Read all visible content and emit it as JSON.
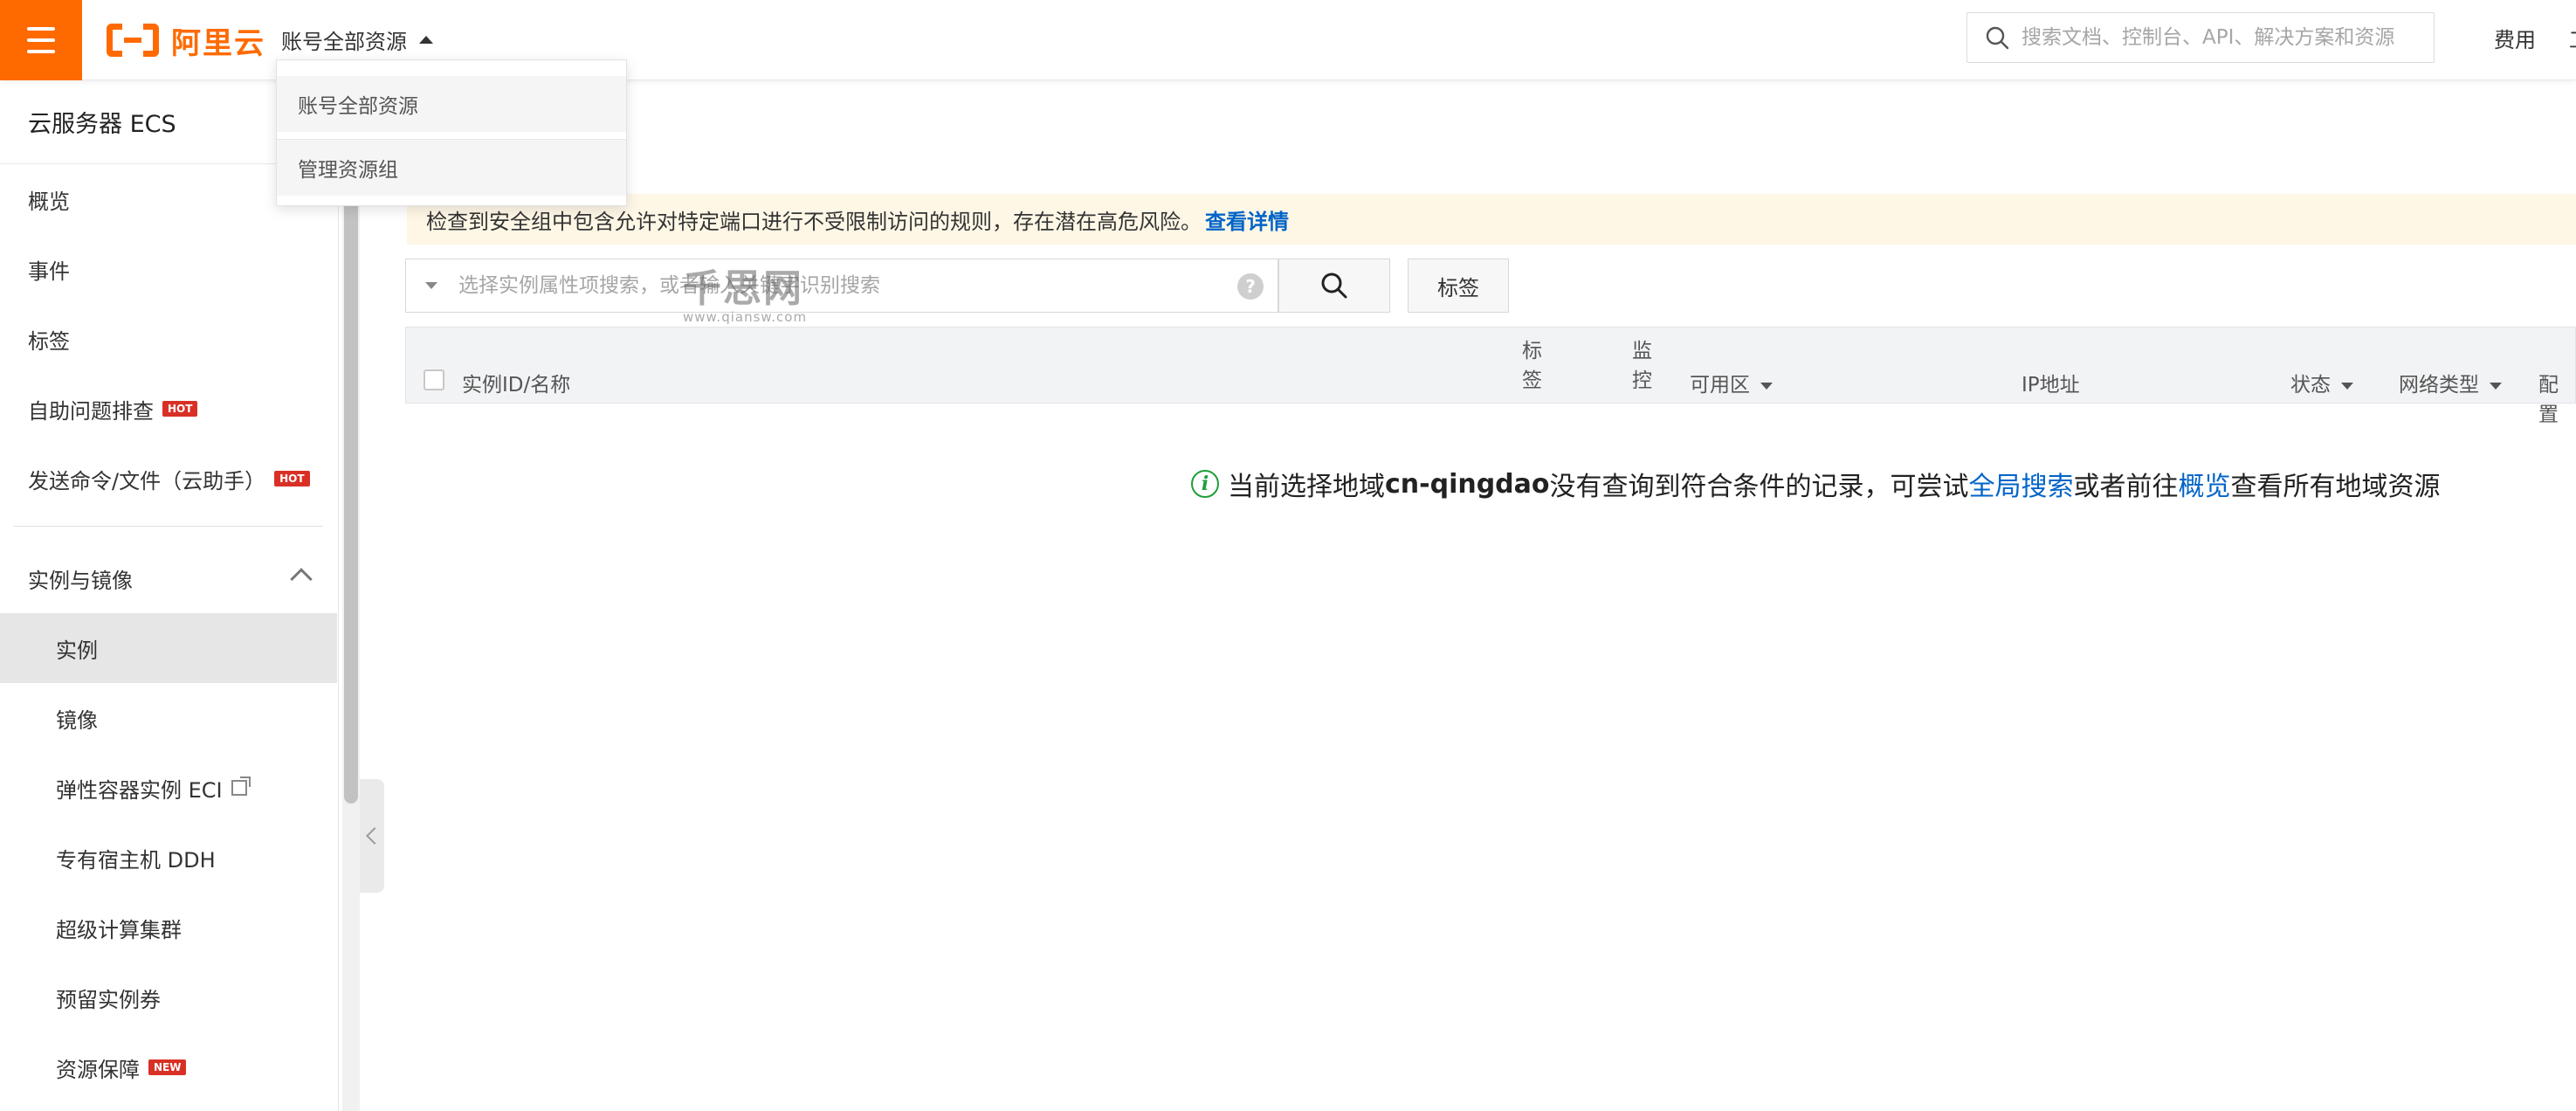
{
  "header": {
    "brand": "阿里云",
    "account_scope": "账号全部资源",
    "search_placeholder": "搜索文档、控制台、API、解决方案和资源",
    "links": [
      "费用",
      "工"
    ]
  },
  "dropdown": {
    "items": [
      "账号全部资源",
      "管理资源组"
    ]
  },
  "sidebar": {
    "title": "云服务器 ECS",
    "items": [
      {
        "label": "概览"
      },
      {
        "label": "事件"
      },
      {
        "label": "标签"
      },
      {
        "label": "自助问题排查",
        "badge": "HOT"
      },
      {
        "label": "发送命令/文件（云助手）",
        "badge": "HOT"
      }
    ],
    "group": {
      "label": "实例与镜像",
      "items": [
        {
          "label": "实例",
          "selected": true
        },
        {
          "label": "镜像"
        },
        {
          "label": "弹性容器实例 ECI",
          "external": true
        },
        {
          "label": "专有宿主机 DDH"
        },
        {
          "label": "超级计算集群"
        },
        {
          "label": "预留实例券"
        },
        {
          "label": "资源保障",
          "badge": "NEW"
        }
      ]
    }
  },
  "alert": {
    "text": "检查到安全组中包含允许对特定端口进行不受限制访问的规则，存在潜在高危风险。",
    "link": "查看详情"
  },
  "filter": {
    "placeholder": "选择实例属性项搜索，或者输入关键字识别搜索",
    "help": "?",
    "tag_button": "标签"
  },
  "watermark": {
    "main": "千思网",
    "sub": "www.qiansw.com"
  },
  "table": {
    "columns": {
      "id_name": "实例ID/名称",
      "tag": "标签",
      "monitor": "监控",
      "zone": "可用区",
      "ip": "IP地址",
      "status": "状态",
      "network": "网络类型",
      "config": "配置"
    }
  },
  "empty": {
    "icon": "i",
    "prefix": "当前选择地域",
    "region": "cn-qingdao",
    "middle": "没有查询到符合条件的记录，可尝试",
    "link1": "全局搜索",
    "between": "或者前往",
    "link2": "概览",
    "suffix": "查看所有地域资源"
  },
  "colors": {
    "brand": "#ff6a00",
    "link": "#0064c8",
    "alert_bg": "#fff7e6",
    "badge": "#d93026",
    "info": "#1e9e3a"
  }
}
